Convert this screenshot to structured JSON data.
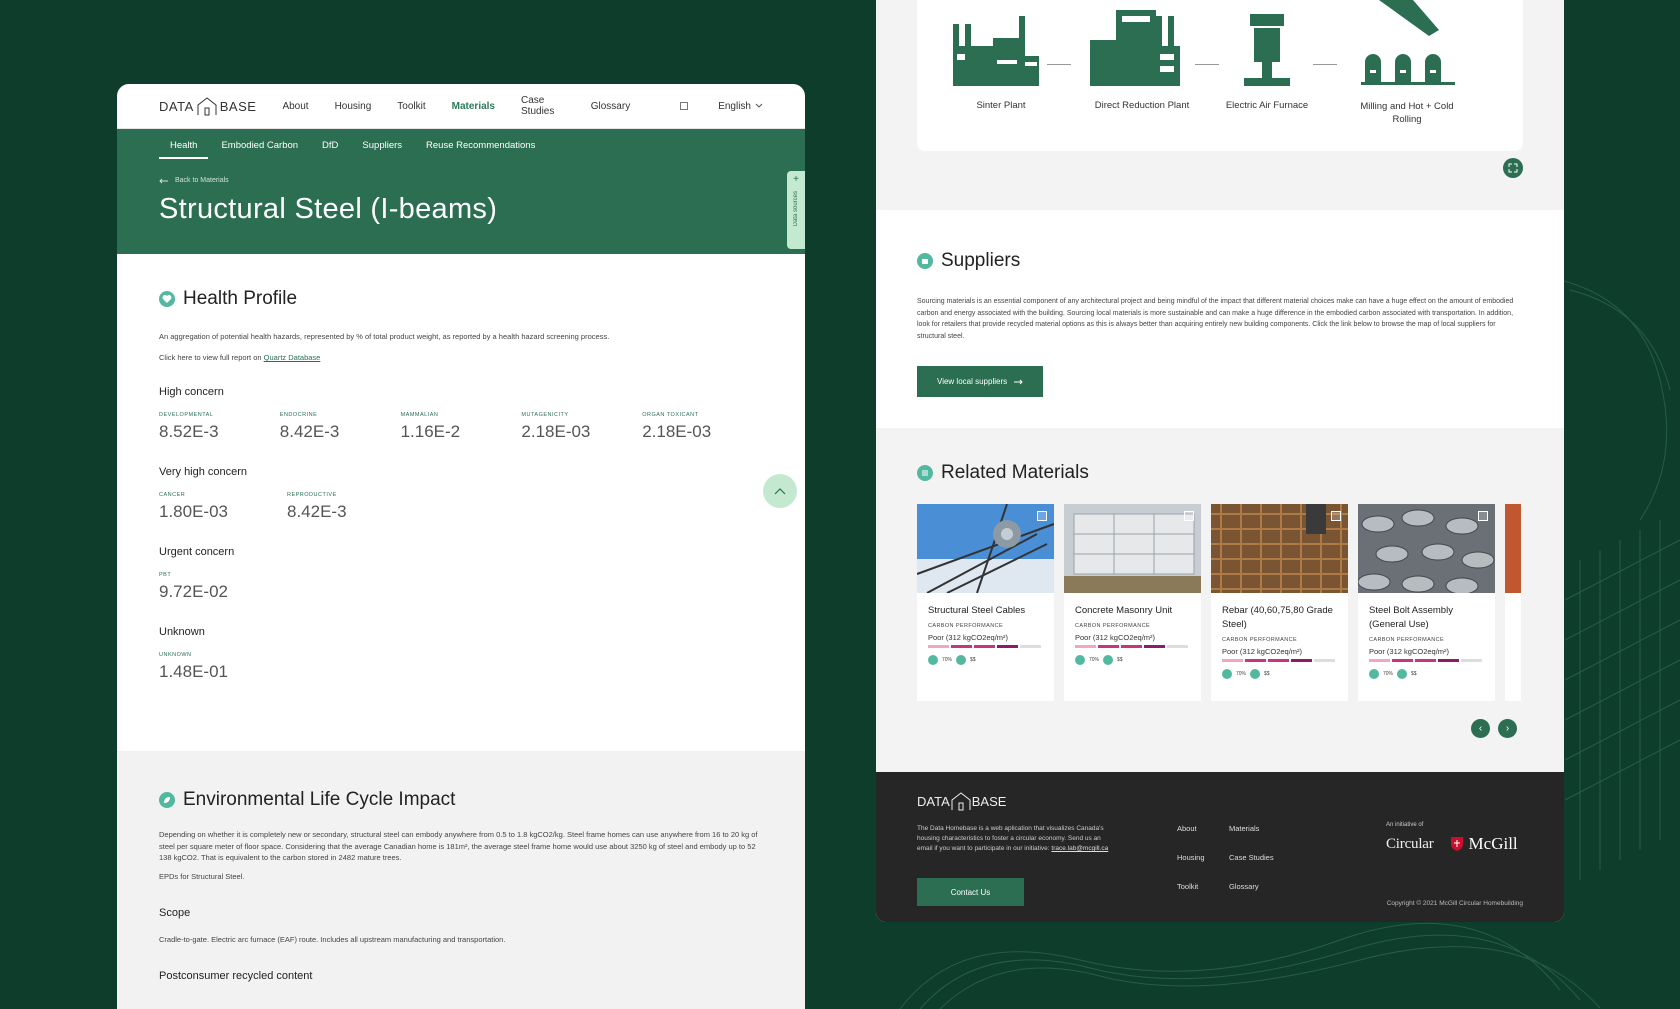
{
  "brand": {
    "left": "DATA",
    "right": "BASE"
  },
  "nav": {
    "items": [
      "About",
      "Housing",
      "Toolkit",
      "Materials",
      "Case Studies",
      "Glossary"
    ],
    "language": "English"
  },
  "subnav": {
    "items": [
      "Health",
      "Embodied Carbon",
      "DfD",
      "Suppliers",
      "Reuse Recommendations"
    ]
  },
  "hero": {
    "back": "Back to Materials",
    "title": "Structural Steel (I-beams)",
    "side_tab": "Data sources"
  },
  "health": {
    "title": "Health Profile",
    "description": "An aggregation of potential health hazards, represented by % of total product weight, as reported by a health hazard screening process.",
    "report_prefix": "Click here to view full report on",
    "report_link": "Quartz Database",
    "groups": [
      {
        "title": "High concern",
        "metrics": [
          {
            "label": "DEVELOPMENTAL",
            "value": "8.52E-3"
          },
          {
            "label": "ENDOCRINE",
            "value": "8.42E-3"
          },
          {
            "label": "MAMMALIAN",
            "value": "1.16E-2"
          },
          {
            "label": "MUTAGENICITY",
            "value": "2.18E-03"
          },
          {
            "label": "ORGAN TOXICANT",
            "value": "2.18E-03"
          }
        ]
      },
      {
        "title": "Very high concern",
        "metrics": [
          {
            "label": "CANCER",
            "value": "1.80E-03"
          },
          {
            "label": "REPRODUCTIVE",
            "value": "8.42E-3"
          }
        ]
      },
      {
        "title": "Urgent concern",
        "metrics": [
          {
            "label": "PBT",
            "value": "9.72E-02"
          }
        ]
      },
      {
        "title": "Unknown",
        "metrics": [
          {
            "label": "UNKNOWN",
            "value": "1.48E-01"
          }
        ]
      }
    ]
  },
  "env": {
    "title": "Environmental Life Cycle Impact",
    "paragraph": "Depending on whether it is completely new or secondary, structural steel can embody anywhere from 0.5 to 1.8 kgCO2/kg. Steel frame homes can use anywhere from 16 to 20 kg of steel per square meter of floor space. Considering that the average Canadian home is 181m², the average steel frame home would use about 3250 kg of steel and embody up to 52 138 kgCO2. That is equivalent to the carbon stored in 2482 mature trees.",
    "epd": "EPDs for Structural Steel.",
    "scope_title": "Scope",
    "scope_text": "Cradle-to-gate. Electric arc furnace (EAF) route. Includes all upstream manufacturing and transportation.",
    "recycled_title": "Postconsumer recycled content"
  },
  "process": {
    "steps": [
      "Sinter Plant",
      "Direct Reduction Plant",
      "Electric Air Furnace",
      "Milling and Hot + Cold Rolling"
    ]
  },
  "suppliers": {
    "title": "Suppliers",
    "paragraph": "Sourcing materials is an essential component of any architectural project and being mindful of the impact that different material choices make can have a huge effect on the amount of embodied carbon and energy associated with the building. Sourcing local materials is more sustainable and can make a huge difference in the embodied carbon associated with transportation. In addition, look for retailers that provide recycled material options as this is always better than acquiring entirely new building components. Click the link below to browse the map of local suppliers for structural steel.",
    "button": "View local suppliers"
  },
  "related": {
    "title": "Related Materials",
    "cards": [
      {
        "name": "Structural Steel Cables",
        "perf_label": "CARBON PERFORMANCE",
        "perf_value": "Poor (312 kgCO2eq/m²)",
        "health": "70%",
        "cost": "$$"
      },
      {
        "name": "Concrete Masonry Unit",
        "perf_label": "CARBON PERFORMANCE",
        "perf_value": "Poor (312 kgCO2eq/m²)",
        "health": "70%",
        "cost": "$$"
      },
      {
        "name": "Rebar (40,60,75,80 Grade Steel)",
        "perf_label": "CARBON PERFORMANCE",
        "perf_value": "Poor (312 kgCO2eq/m²)",
        "health": "70%",
        "cost": "$$"
      },
      {
        "name": "Steel Bolt Assembly (General Use)",
        "perf_label": "CARBON PERFORMANCE",
        "perf_value": "Poor (312 kgCO2eq/m²)",
        "health": "70%",
        "cost": "$$"
      }
    ]
  },
  "footer": {
    "description": "The Data Homebase is a web aplication that visualizes Canada's housing characteristics to foster a circular economy. Send us an email if you want to participate in our initiative:",
    "email": "trace.lab@mcgill.ca",
    "contact": "Contact Us",
    "links": [
      "About",
      "Materials",
      "Housing",
      "Case Studies",
      "Toolkit",
      "Glossary"
    ],
    "initiative": "An initiative of",
    "partner1": "Circular",
    "partner2": "McGill",
    "copyright": "Copyright © 2021 McGill Circular Homebuilding"
  },
  "colors": {
    "primary": "#2b6e52",
    "background": "#0f3d2b",
    "accent_light": "#c3ead1",
    "icon": "#53b8a0"
  }
}
